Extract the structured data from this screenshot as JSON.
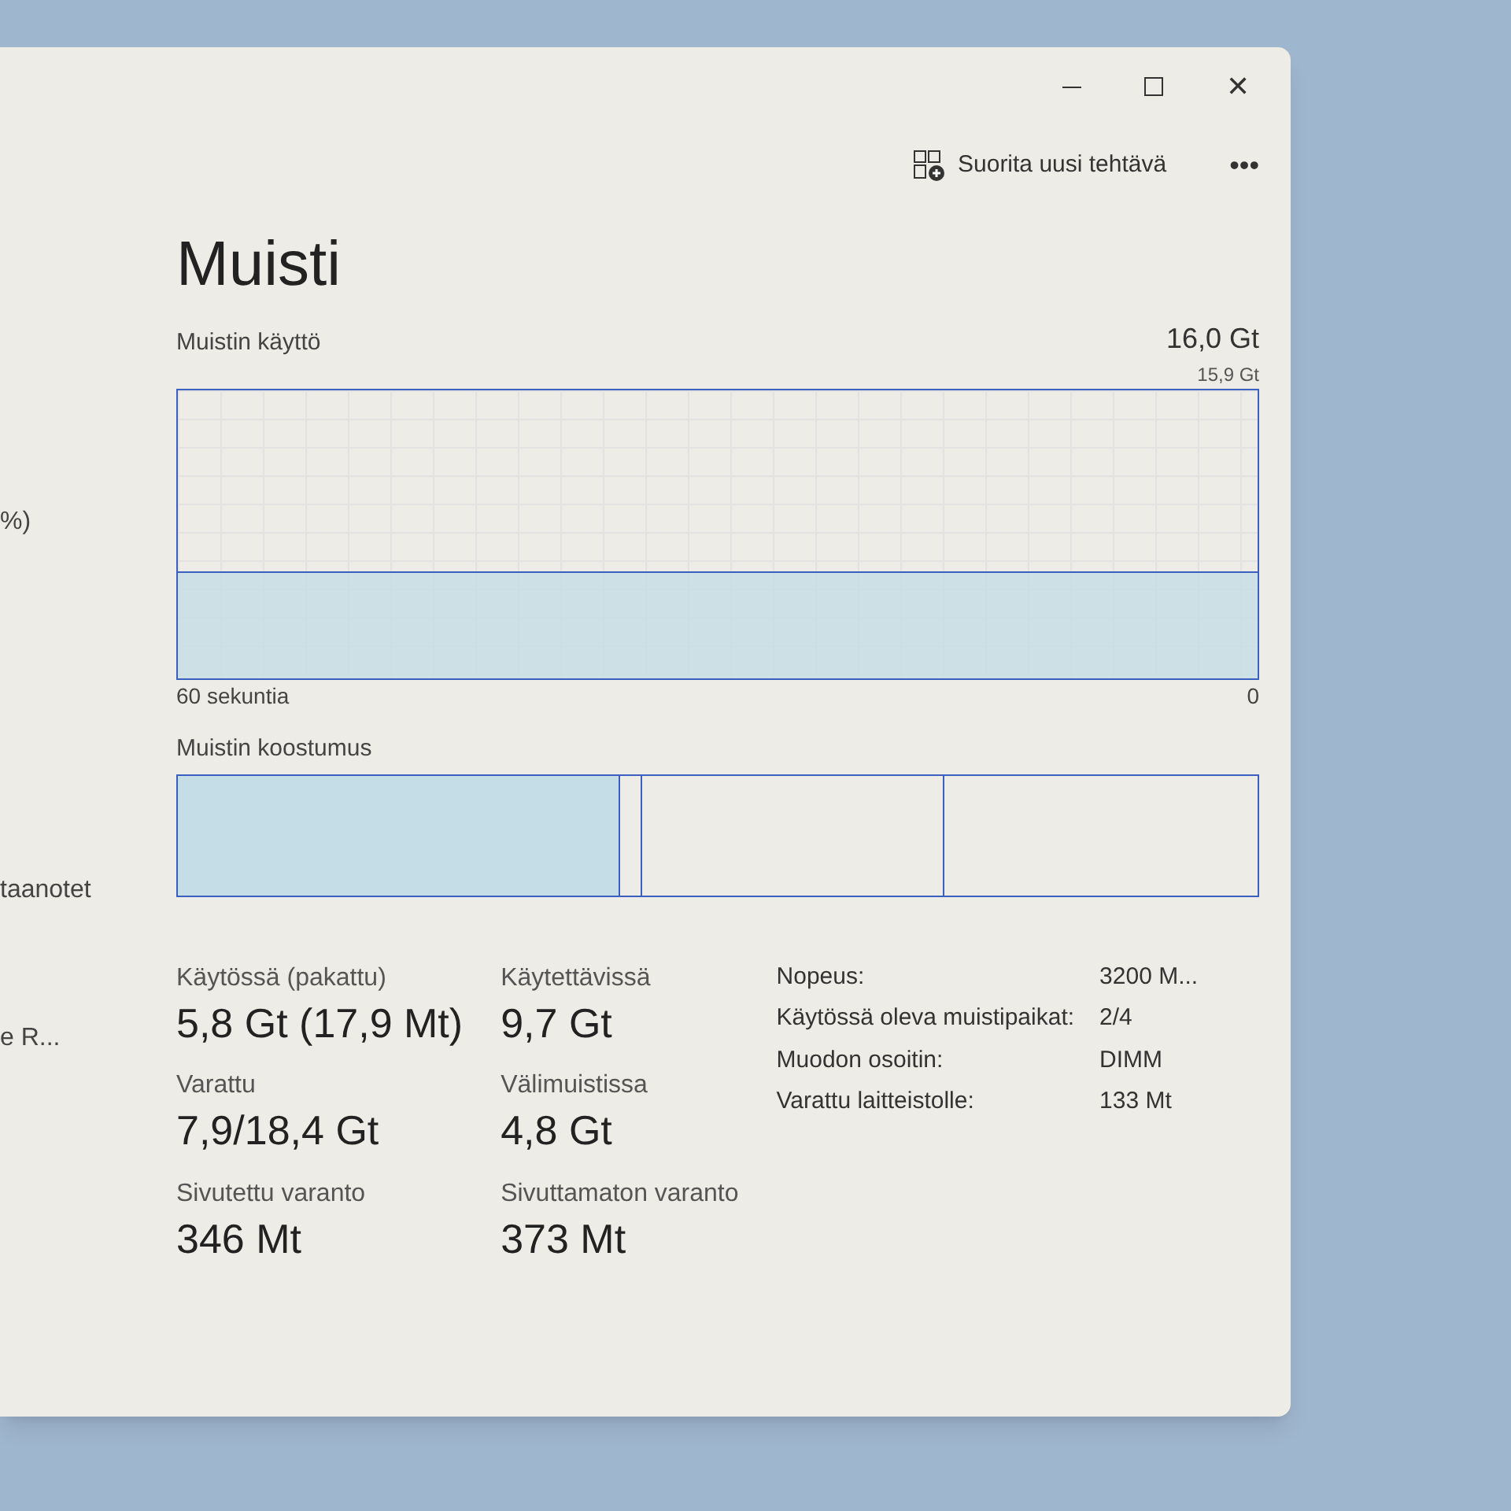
{
  "sidebar": {
    "items": [
      {
        "label": "%)"
      },
      {
        "label": "taanotet"
      },
      {
        "label": "e R..."
      }
    ]
  },
  "window": {
    "close": "✕"
  },
  "toolbar": {
    "run_task": "Suorita uusi tehtävä",
    "more": "•••"
  },
  "page": {
    "title": "Muisti",
    "usage_label": "Muistin käyttö",
    "total": "16,0 Gt",
    "graph_max": "15,9 Gt",
    "graph_time": "60 sekuntia",
    "graph_min": "0",
    "composition_label": "Muistin koostumus",
    "composition": {
      "level": 0.41
    }
  },
  "stats": [
    {
      "label": "Käytössä (pakattu)",
      "value": "5,8 Gt (17,9 Mt)"
    },
    {
      "label": "Käytettävissä",
      "value": "9,7 Gt"
    },
    {
      "label": "Varattu",
      "value": "7,9/18,4 Gt"
    },
    {
      "label": "Välimuistissa",
      "value": "4,8 Gt"
    },
    {
      "label": "Sivutettu varanto",
      "value": "346 Mt"
    },
    {
      "label": "Sivuttamaton varanto",
      "value": "373 Mt"
    }
  ],
  "details": [
    {
      "label": "Nopeus:",
      "value": "3200 M..."
    },
    {
      "label": "Käytössä oleva muistipaikat:",
      "value": "2/4"
    },
    {
      "label": "Muodon osoitin:",
      "value": "DIMM"
    },
    {
      "label": "Varattu laitteistolle:",
      "value": "133 Mt"
    }
  ]
}
